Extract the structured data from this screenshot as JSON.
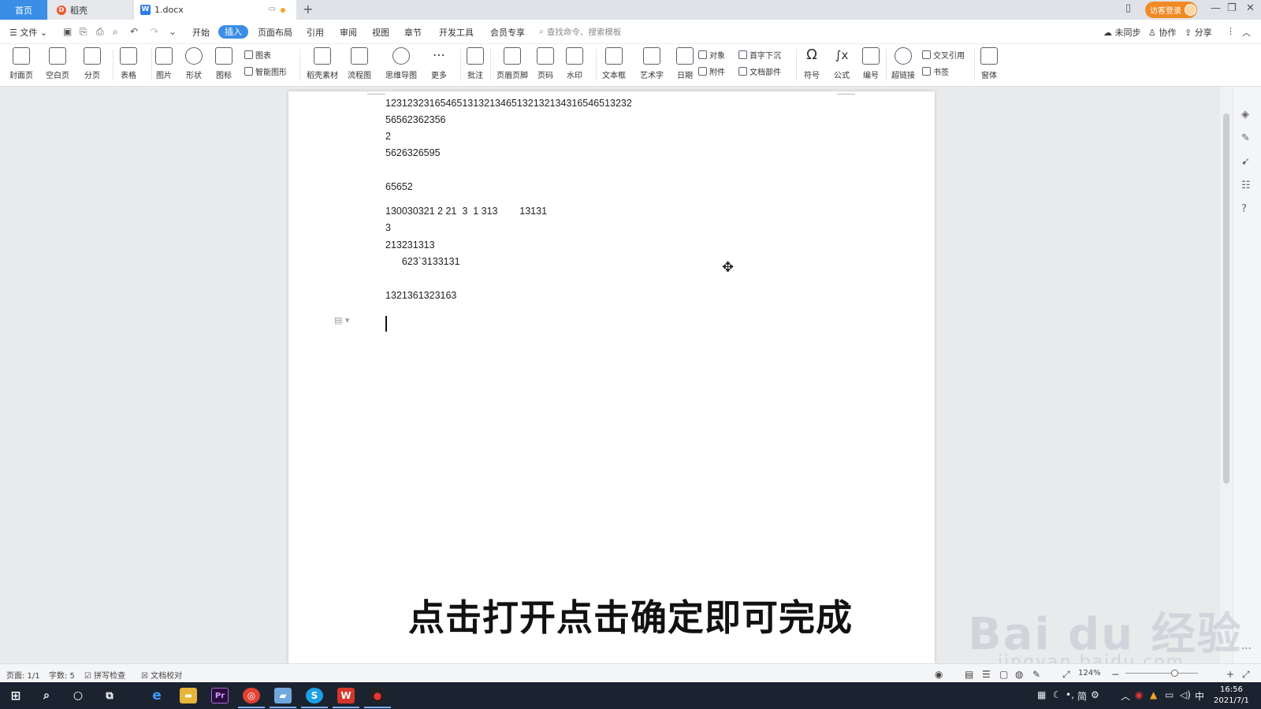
{
  "tabs": {
    "home": "首页",
    "daoke": "稻壳",
    "doc": "1.docx",
    "add": "+"
  },
  "titlebar": {
    "login": "访客登录",
    "min": "—",
    "restore": "❐",
    "close": "✕"
  },
  "menu": {
    "file": "文件",
    "items": [
      "开始",
      "插入",
      "页面布局",
      "引用",
      "审阅",
      "视图",
      "章节",
      "开发工具",
      "会员专享"
    ],
    "search_placeholder": "查找命令、搜索模板",
    "sync": "未同步",
    "collab": "协作",
    "share": "分享"
  },
  "ribbon": {
    "cover": "封面页",
    "blank": "空白页",
    "pagebreak": "分页",
    "table": "表格",
    "picture": "图片",
    "shape": "形状",
    "icons": "图标",
    "chart": "图表",
    "smartart": "智能图形",
    "daoke_assets": "稻壳素材",
    "flowchart": "流程图",
    "mindmap": "思维导图",
    "more": "更多",
    "comment": "批注",
    "header_footer": "页眉页脚",
    "page_number": "页码",
    "watermark": "水印",
    "textbox": "文本框",
    "wordart": "艺术字",
    "date": "日期",
    "object": "对象",
    "dropcap": "首字下沉",
    "attachment": "附件",
    "doc_parts": "文档部件",
    "symbol": "符号",
    "formula": "公式",
    "numbering": "编号",
    "hyperlink": "超链接",
    "crossref": "交叉引用",
    "bookmark": "书签",
    "font_form": "窗体"
  },
  "document": {
    "lines": [
      "123123231654651313213465132132134316546513232",
      "56562362356",
      "2",
      "5626326595",
      "65652",
      "130030321 2 21  3  1 313        13131",
      "3",
      "213231313",
      "      623`3133131",
      "1321361323163"
    ]
  },
  "subtitle": "点击打开点击确定即可完成",
  "watermark": {
    "main": "Bai du 经验",
    "sub": "jingyan.baidu.com"
  },
  "status": {
    "page": "页面: 1/1",
    "words": "字数: 5",
    "spell": "拼写检查",
    "proof": "文档校对",
    "zoom": "124%"
  },
  "taskbar": {
    "ime_lang": "中",
    "time": "16:56",
    "date": "2021/7/1",
    "ime_mode": "简"
  },
  "colors": {
    "accent": "#3a8ee6",
    "login": "#f08a24",
    "taskbar": "#1c2330"
  }
}
